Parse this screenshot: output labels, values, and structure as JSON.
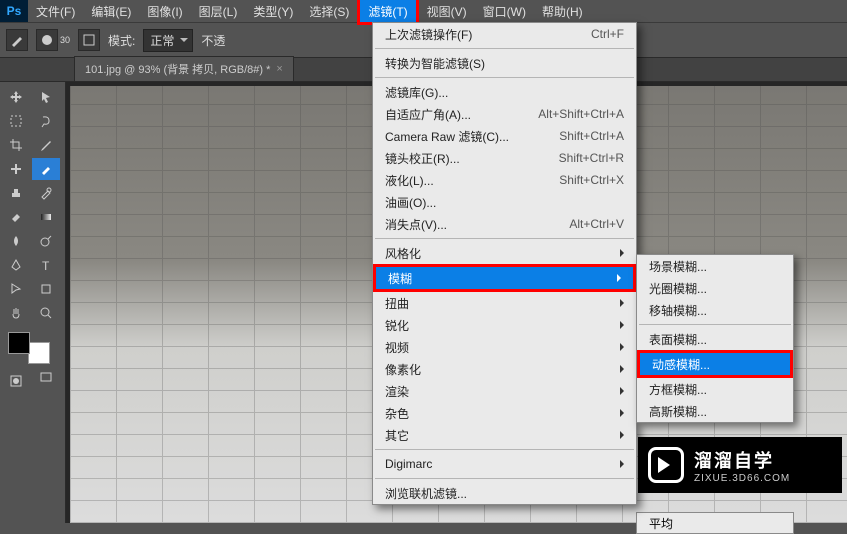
{
  "app": {
    "logo": "Ps"
  },
  "menubar": [
    {
      "label": "文件(F)"
    },
    {
      "label": "编辑(E)"
    },
    {
      "label": "图像(I)"
    },
    {
      "label": "图层(L)"
    },
    {
      "label": "类型(Y)"
    },
    {
      "label": "选择(S)"
    },
    {
      "label": "滤镜(T)",
      "active": true
    },
    {
      "label": "视图(V)"
    },
    {
      "label": "窗口(W)"
    },
    {
      "label": "帮助(H)"
    }
  ],
  "optbar": {
    "mode_label": "模式:",
    "mode_value": "正常",
    "opacity_prefix": "不透",
    "brush_size": "30"
  },
  "doc_tab": {
    "title": "101.jpg @ 93% (背景 拷贝, RGB/8#) *",
    "close": "×"
  },
  "filter_menu": {
    "top": {
      "label": "上次滤镜操作(F)",
      "shortcut": "Ctrl+F"
    },
    "g2": [
      {
        "label": "转换为智能滤镜(S)"
      }
    ],
    "g3": [
      {
        "label": "滤镜库(G)..."
      },
      {
        "label": "自适应广角(A)...",
        "shortcut": "Alt+Shift+Ctrl+A"
      },
      {
        "label": "Camera Raw 滤镜(C)...",
        "shortcut": "Shift+Ctrl+A"
      },
      {
        "label": "镜头校正(R)...",
        "shortcut": "Shift+Ctrl+R"
      },
      {
        "label": "液化(L)...",
        "shortcut": "Shift+Ctrl+X"
      },
      {
        "label": "油画(O)..."
      },
      {
        "label": "消失点(V)...",
        "shortcut": "Alt+Ctrl+V"
      }
    ],
    "g4": [
      {
        "label": "风格化",
        "sub": true
      },
      {
        "label": "模糊",
        "sub": true,
        "hl": true
      },
      {
        "label": "扭曲",
        "sub": true
      },
      {
        "label": "锐化",
        "sub": true
      },
      {
        "label": "视频",
        "sub": true
      },
      {
        "label": "像素化",
        "sub": true
      },
      {
        "label": "渲染",
        "sub": true
      },
      {
        "label": "杂色",
        "sub": true
      },
      {
        "label": "其它",
        "sub": true
      }
    ],
    "g5": [
      {
        "label": "Digimarc",
        "sub": true
      }
    ],
    "g6": [
      {
        "label": "浏览联机滤镜..."
      }
    ]
  },
  "blur_submenu": [
    {
      "label": "场景模糊..."
    },
    {
      "label": "光圈模糊..."
    },
    {
      "label": "移轴模糊..."
    },
    {
      "label": "表面模糊...",
      "sep_before": true
    },
    {
      "label": "动感模糊...",
      "hl": true
    },
    {
      "label": "方框模糊..."
    },
    {
      "label": "高斯模糊..."
    },
    {
      "label": "平均",
      "tail": true
    }
  ],
  "watermark": {
    "title": "溜溜自学",
    "url": "ZIXUE.3D66.COM"
  }
}
